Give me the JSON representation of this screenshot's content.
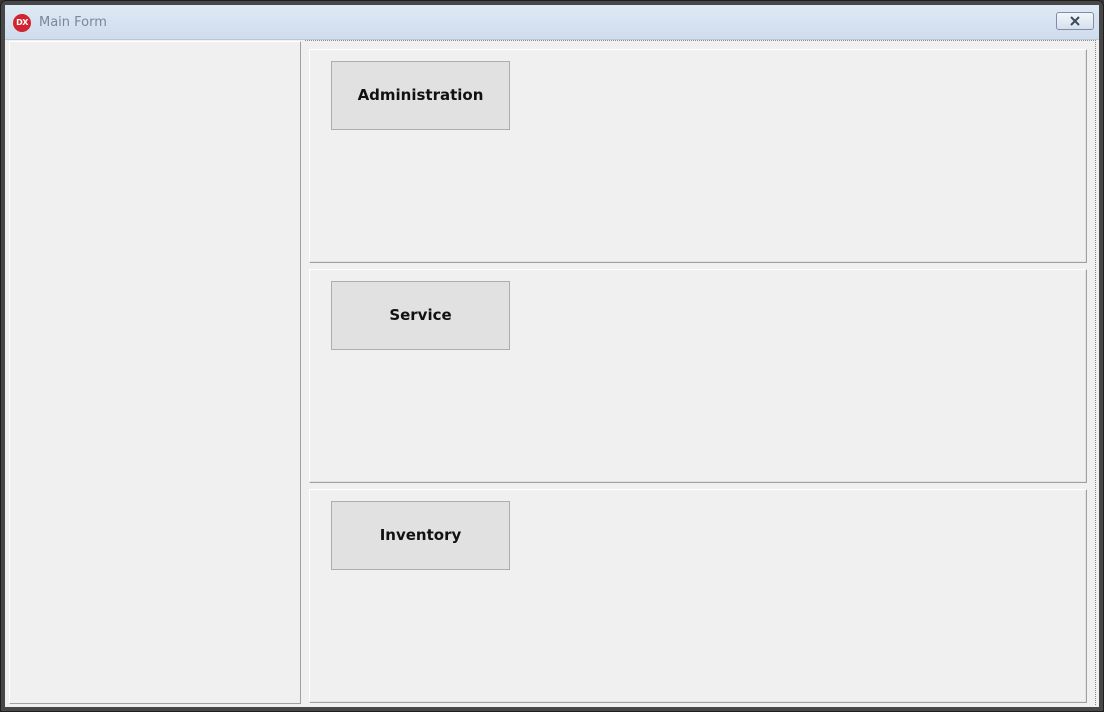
{
  "window": {
    "title": "Main Form",
    "app_icon_text": "DX",
    "app_icon_color": "#d1242f"
  },
  "sections": [
    {
      "button_label": "Administration"
    },
    {
      "button_label": "Service"
    },
    {
      "button_label": "Inventory"
    }
  ],
  "colors": {
    "form_background": "#f0f0f0",
    "button_background": "#e1e1e1",
    "titlebar_text": "#7b8794"
  }
}
